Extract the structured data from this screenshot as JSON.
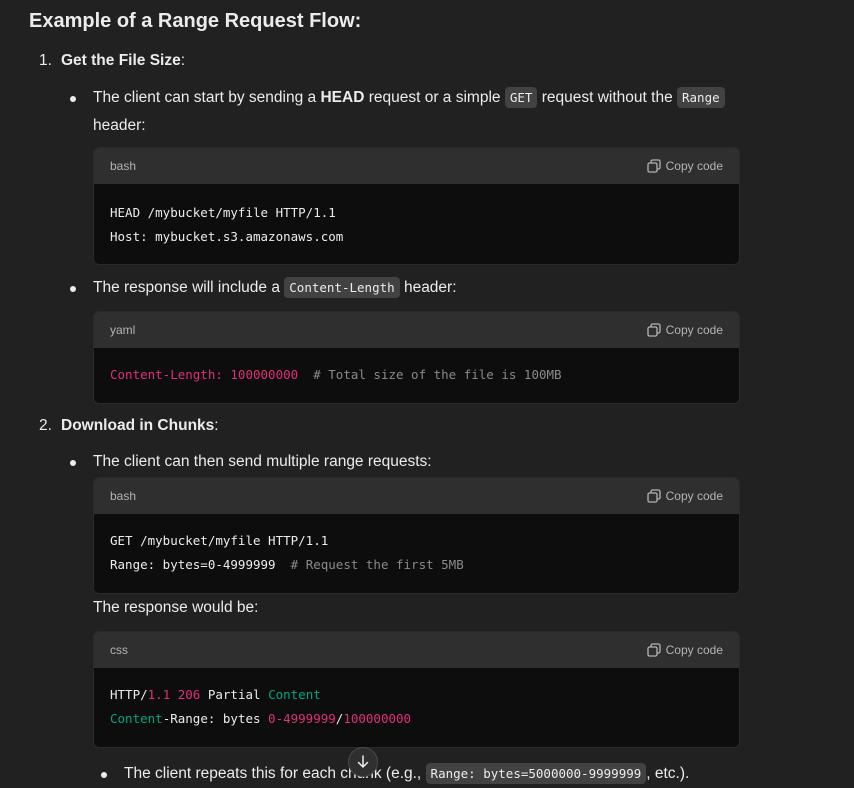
{
  "heading": "Example of a Range Request Flow:",
  "step1": {
    "num": "1.",
    "title": "Get the File Size",
    "colon": ":",
    "bullet1": {
      "t1": "The client can start by sending a ",
      "b1": "HEAD",
      "t2": " request or a simple ",
      "c1": "GET",
      "t3": " request without the ",
      "c2": "Range",
      "t4": " header:"
    },
    "code1": {
      "lang": "bash",
      "copy": "Copy code",
      "line1": "HEAD /mybucket/myfile HTTP/1.1",
      "line2": "Host: mybucket.s3.amazonaws.com"
    },
    "bullet2": {
      "t1": "The response will include a ",
      "c1": "Content-Length",
      "t2": " header:"
    },
    "code2": {
      "lang": "yaml",
      "copy": "Copy code",
      "key": "Content-Length: 100000000",
      "comment": "# Total size of the file is 100MB"
    }
  },
  "step2": {
    "num": "2.",
    "title": "Download in Chunks",
    "colon": ":",
    "bullet1": "The client can then send multiple range requests:",
    "code1": {
      "lang": "bash",
      "copy": "Copy code",
      "line1": "GET /mybucket/myfile HTTP/1.1",
      "line2": "Range: bytes=0-4999999",
      "comment": "# Request the first 5MB"
    },
    "response_label": "The response would be:",
    "code2": {
      "lang": "css",
      "copy": "Copy code",
      "l1a": "HTTP/",
      "l1b": "1.1 206",
      "l1c": " Partial ",
      "l1d": "Content",
      "l2a": "Content",
      "l2b": "-Range: bytes ",
      "l2c": "0",
      "l2d": "-4999999",
      "l2e": "/",
      "l2f": "100000000"
    },
    "sub_bullet": {
      "t1": "The client repeats this for each chunk (e.g., ",
      "c1": "Range: bytes=5000000-9999999",
      "t2": ", etc.)."
    }
  },
  "icons": {
    "copy": "copy-icon",
    "scroll": "arrow-down-icon"
  }
}
